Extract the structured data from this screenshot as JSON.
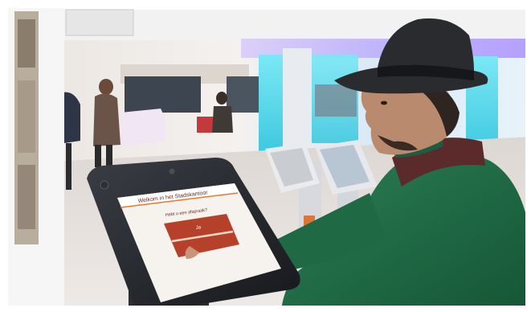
{
  "kiosk": {
    "screen_title": "Welkom in het Stadskantoor",
    "screen_question": "Hebt u een afspraak?",
    "screen_button": "Ja"
  },
  "colors": {
    "screen_accent": "#e8782e",
    "button_red": "#b5412a",
    "sweater_green": "#1f6a45",
    "ambient_cyan": "#5fe0f0",
    "ambient_violet": "#8a5cff"
  }
}
